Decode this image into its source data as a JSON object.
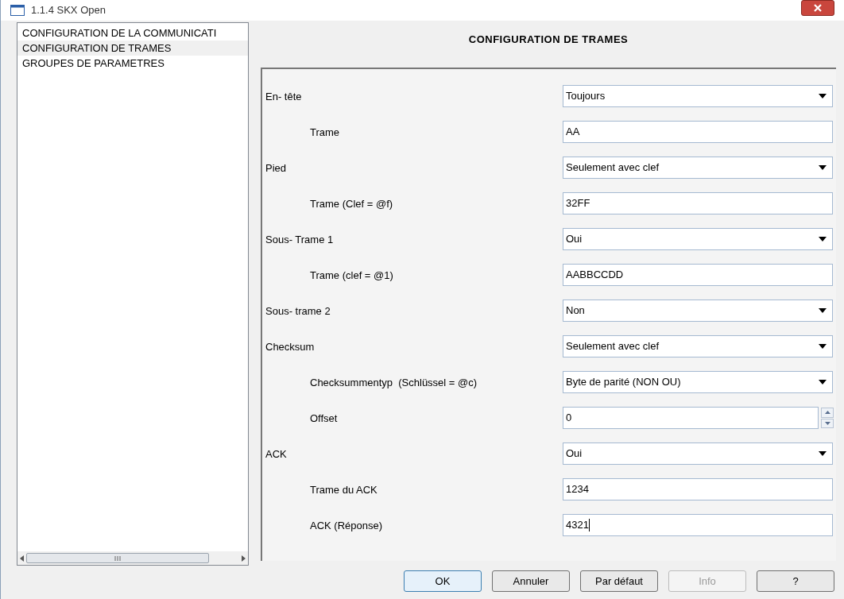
{
  "window": {
    "title": "1.1.4 SKX Open"
  },
  "sidebar": {
    "items": [
      {
        "label": "CONFIGURATION DE LA COMMUNICATI",
        "selected": false
      },
      {
        "label": "CONFIGURATION DE TRAMES",
        "selected": true
      },
      {
        "label": "GROUPES DE PARAMETRES",
        "selected": false
      }
    ]
  },
  "panel": {
    "title": "CONFIGURATION DE TRAMES",
    "rows": [
      {
        "label": "En- tête",
        "kind": "dropdown",
        "value": "Toujours",
        "children": [
          {
            "label": "Trame",
            "kind": "text",
            "value": "AA"
          }
        ]
      },
      {
        "label": "Pied",
        "kind": "dropdown",
        "value": "Seulement avec clef",
        "children": [
          {
            "label": "Trame (Clef = @f)",
            "kind": "text",
            "value": "32FF"
          }
        ]
      },
      {
        "label": "Sous- Trame 1",
        "kind": "dropdown",
        "value": "Oui",
        "children": [
          {
            "label": "Trame (clef = @1)",
            "kind": "text",
            "value": "AABBCCDD"
          }
        ]
      },
      {
        "label": "Sous- trame 2",
        "kind": "dropdown",
        "value": "Non"
      },
      {
        "label": "Checksum",
        "kind": "dropdown",
        "value": "Seulement avec clef",
        "children": [
          {
            "label": "Checksummentyp  (Schlüssel = @c)",
            "kind": "dropdown",
            "value": "Byte de parité (NON OU)"
          },
          {
            "label": "Offset",
            "kind": "spin",
            "value": "0"
          }
        ]
      },
      {
        "label": "ACK",
        "kind": "dropdown",
        "value": "Oui",
        "children": [
          {
            "label": "Trame du ACK",
            "kind": "text",
            "value": "1234"
          },
          {
            "label": "ACK (Réponse)",
            "kind": "text",
            "value": "4321",
            "focused": true
          }
        ]
      }
    ]
  },
  "buttons": [
    {
      "label": "OK",
      "disabled": false,
      "default": true
    },
    {
      "label": "Annuler",
      "disabled": false,
      "default": false
    },
    {
      "label": "Par défaut",
      "disabled": false,
      "default": false
    },
    {
      "label": "Info",
      "disabled": true,
      "default": false
    },
    {
      "label": "?",
      "disabled": false,
      "default": false
    }
  ]
}
